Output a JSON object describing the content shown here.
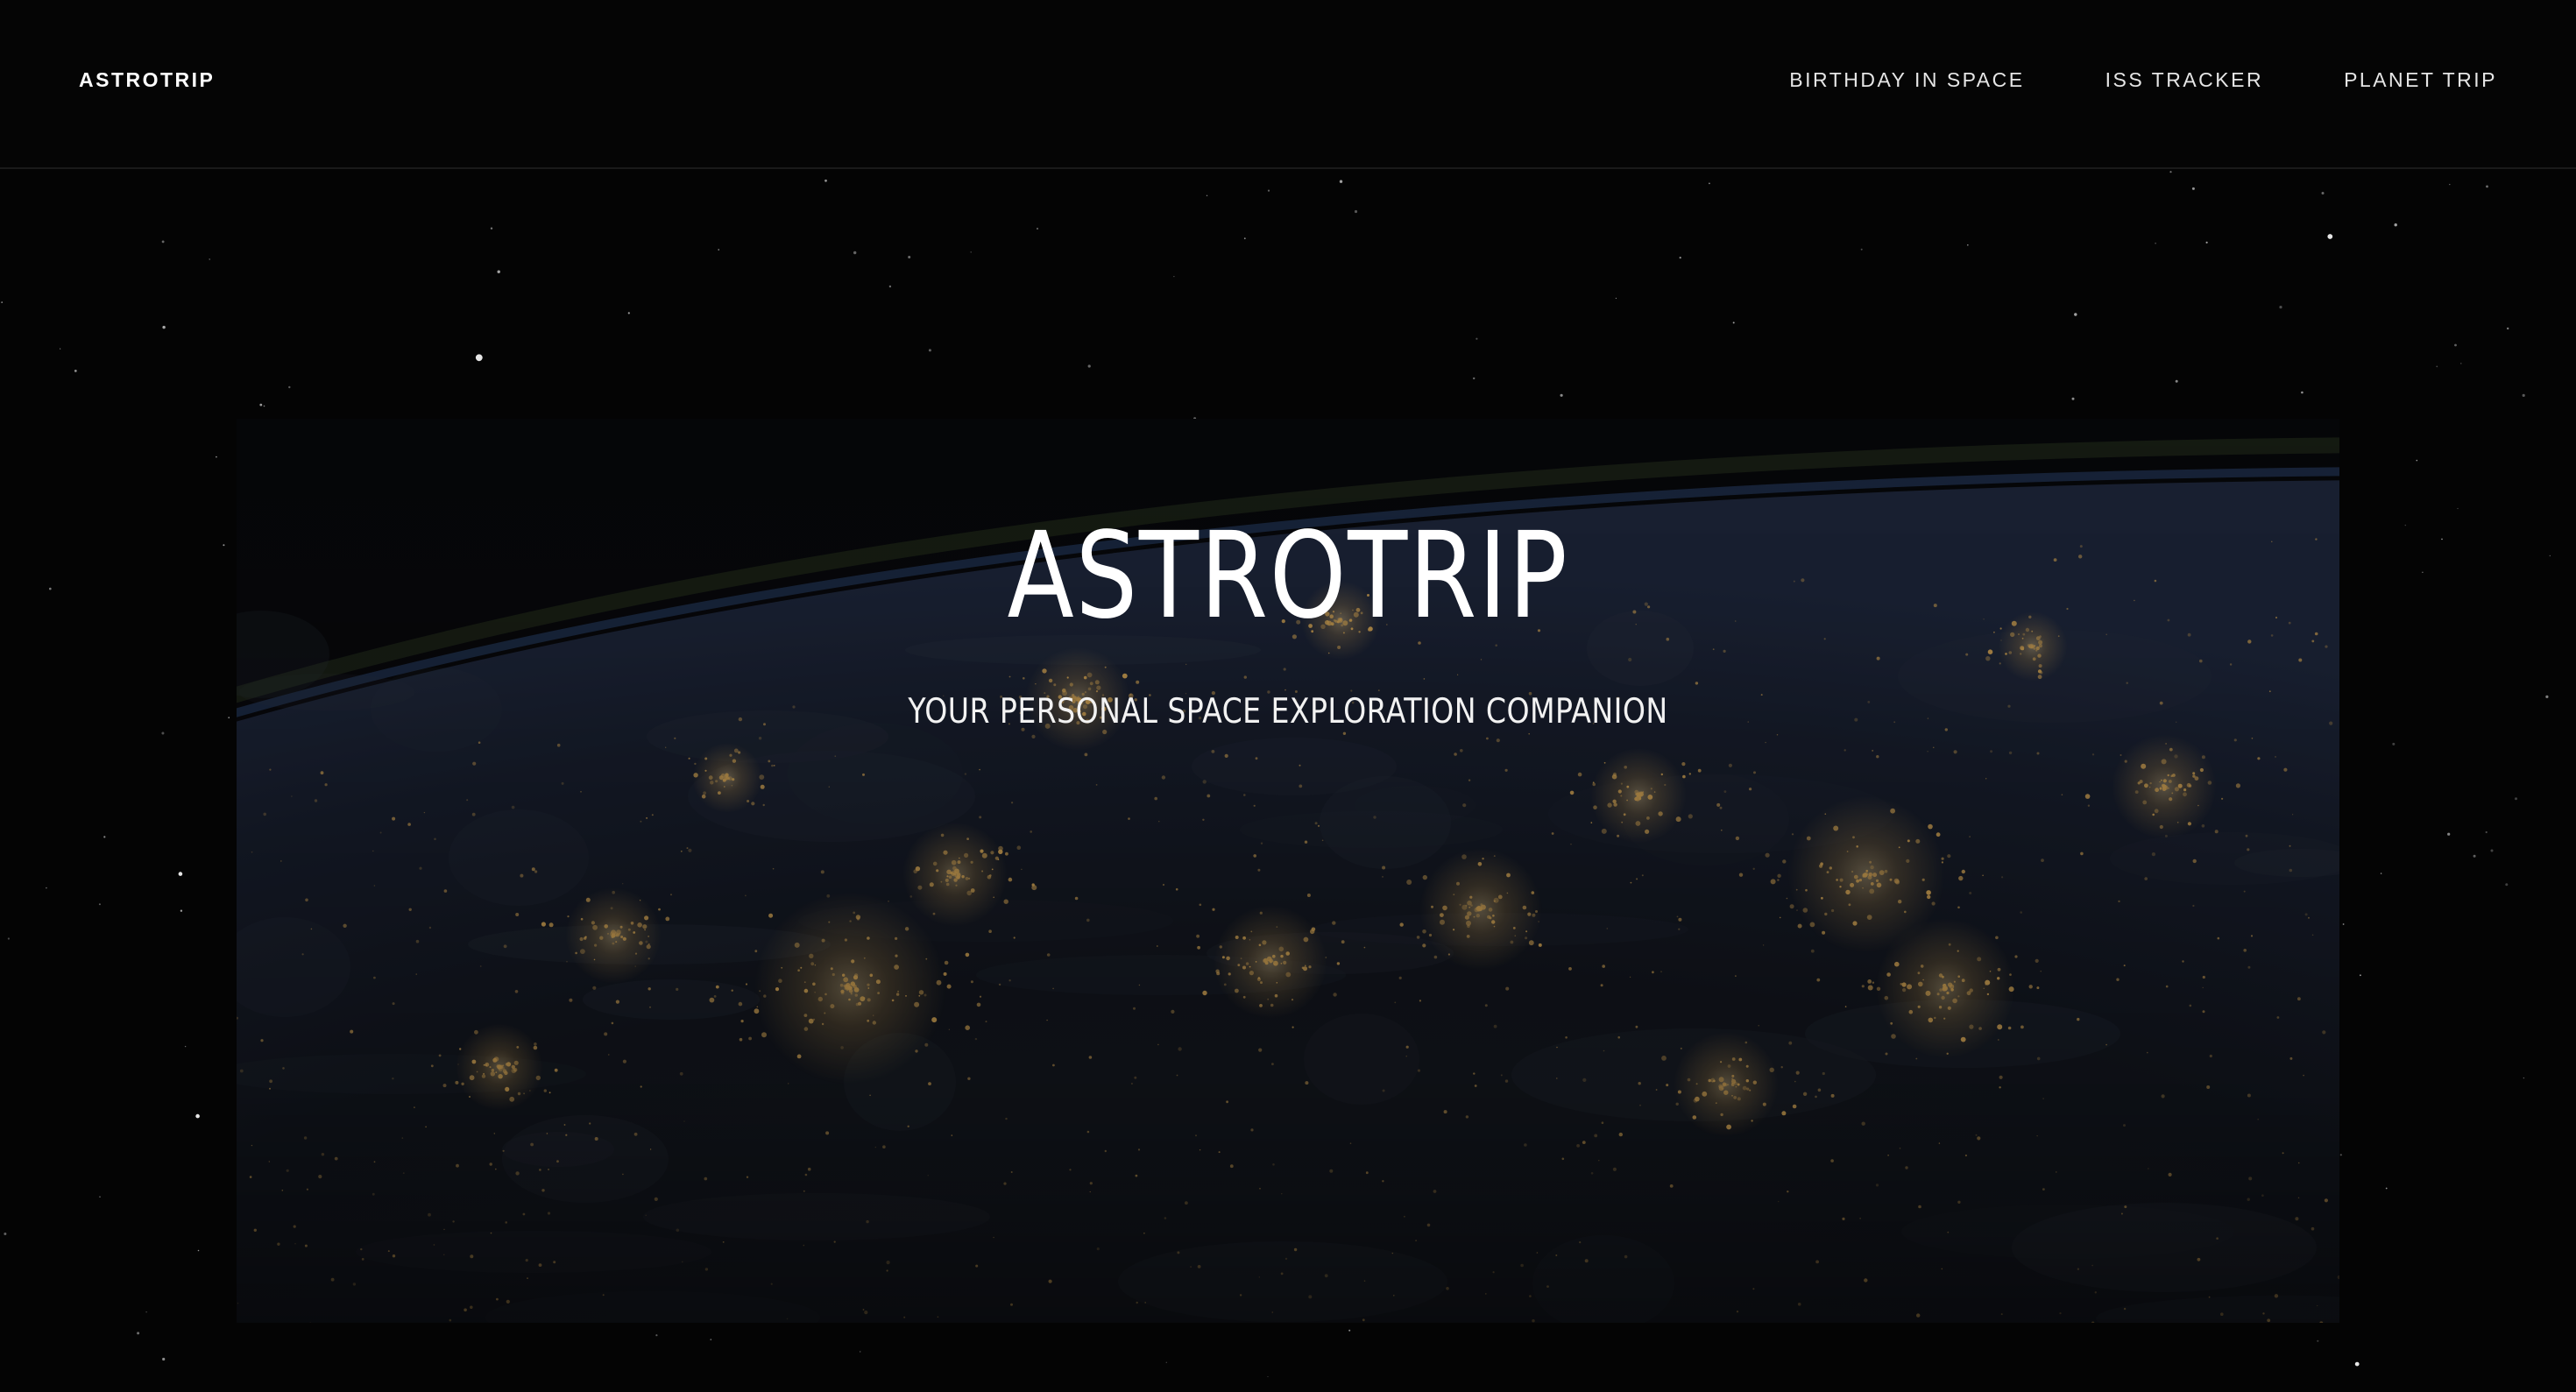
{
  "header": {
    "brand": "ASTROTRIP",
    "nav": [
      {
        "label": "BIRTHDAY IN SPACE"
      },
      {
        "label": "ISS TRACKER"
      },
      {
        "label": "PLANET TRIP"
      }
    ]
  },
  "hero": {
    "title": "ASTROTRIP",
    "subtitle": "YOUR PERSONAL SPACE EXPLORATION COMPANION",
    "image": "earth-at-night-image"
  },
  "colors": {
    "background": "#040404",
    "text": "#ffffff",
    "city_lights": "#e9b65f",
    "atmosphere": "#3a5a8c"
  }
}
